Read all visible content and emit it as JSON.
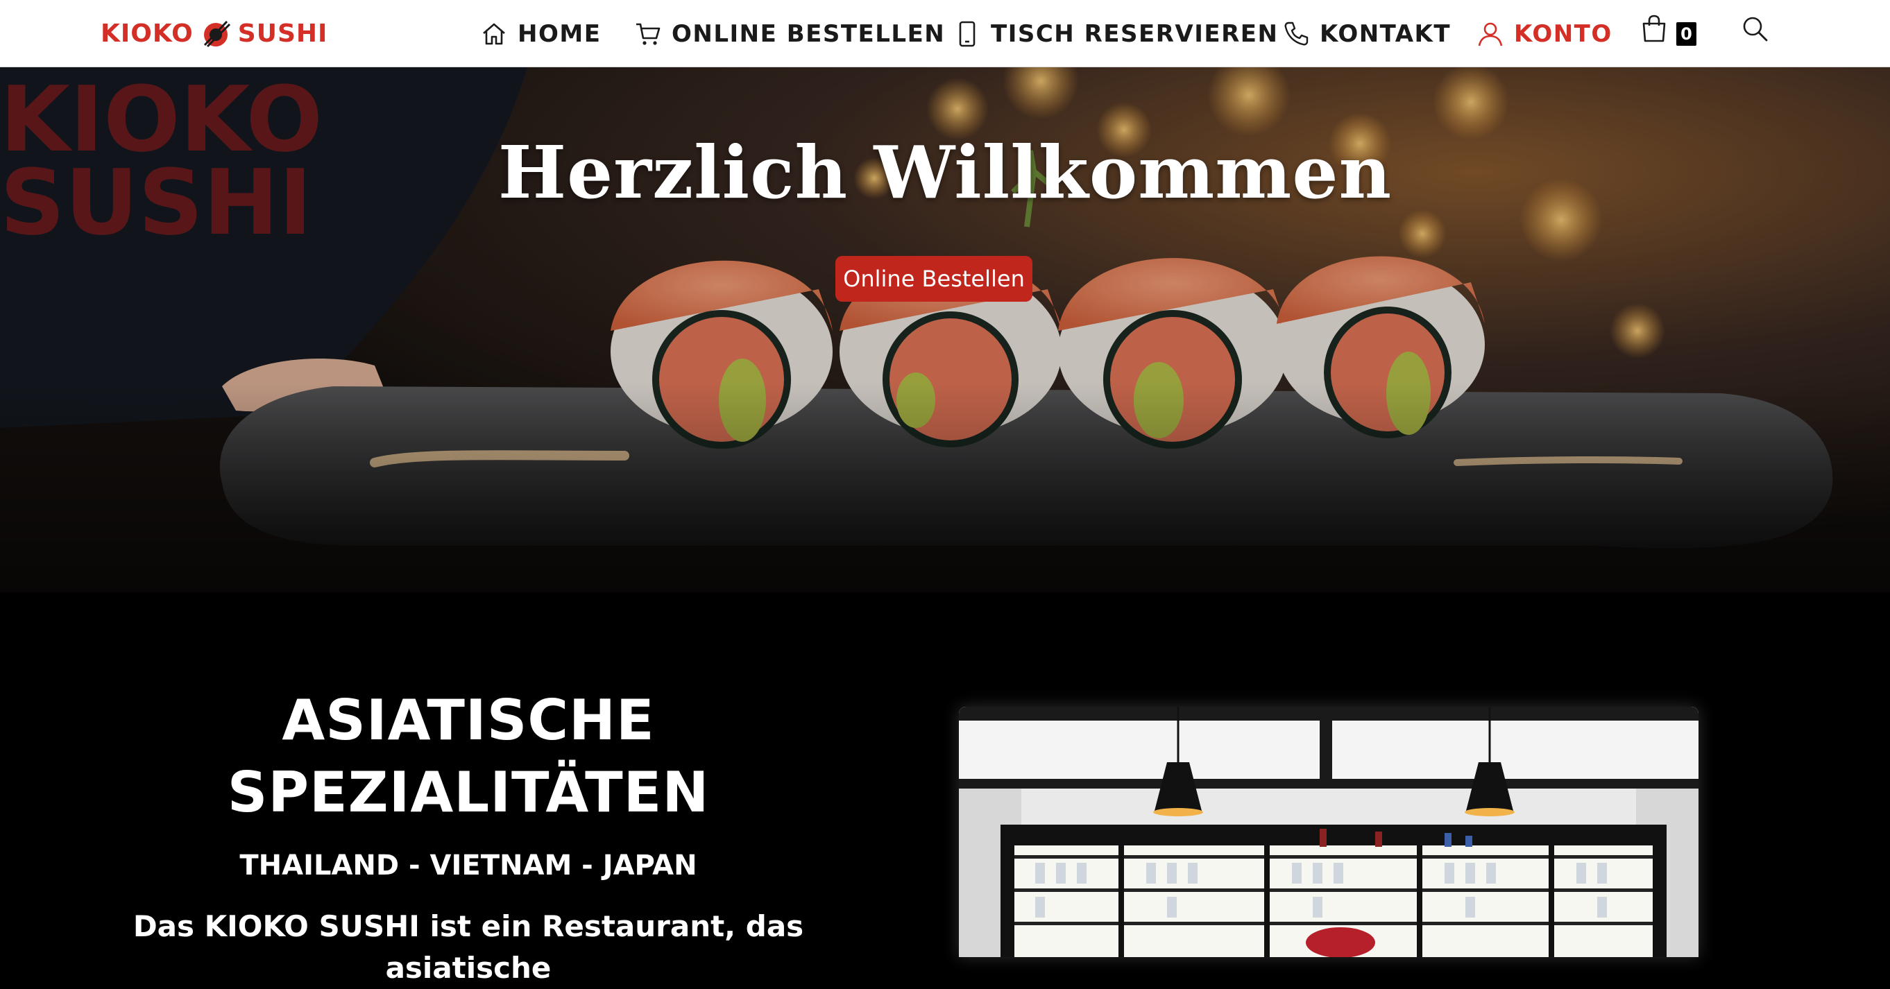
{
  "header": {
    "logo": {
      "text_left": "KIOKO",
      "text_right": "SUSHI",
      "icon": "sushi-chopsticks-icon"
    },
    "nav": [
      {
        "label": "HOME",
        "icon": "home-icon"
      },
      {
        "label": "ONLINE BESTELLEN",
        "icon": "cart-icon"
      },
      {
        "label": "TISCH RESERVIEREN",
        "icon": "smartphone-icon"
      },
      {
        "label": "KONTAKT",
        "icon": "phone-icon"
      },
      {
        "label": "KONTO",
        "icon": "user-icon"
      }
    ],
    "cart": {
      "count": "0",
      "icon": "shopping-bag-icon"
    },
    "search": {
      "icon": "search-icon"
    }
  },
  "hero": {
    "title": "Herzlich Willkommen",
    "button_label": "Online Bestellen"
  },
  "intro": {
    "heading_line1": "ASIATISCHE",
    "heading_line2": "SPEZIALITÄTEN",
    "subheading": "THAILAND - VIETNAM - JAPAN",
    "body": "Das KIOKO SUSHI ist ein Restaurant, das asiatische"
  },
  "colors": {
    "brand_red": "#d42f27",
    "button_red": "#c0261c",
    "header_bg": "#ffffff",
    "page_bg": "#000000"
  }
}
